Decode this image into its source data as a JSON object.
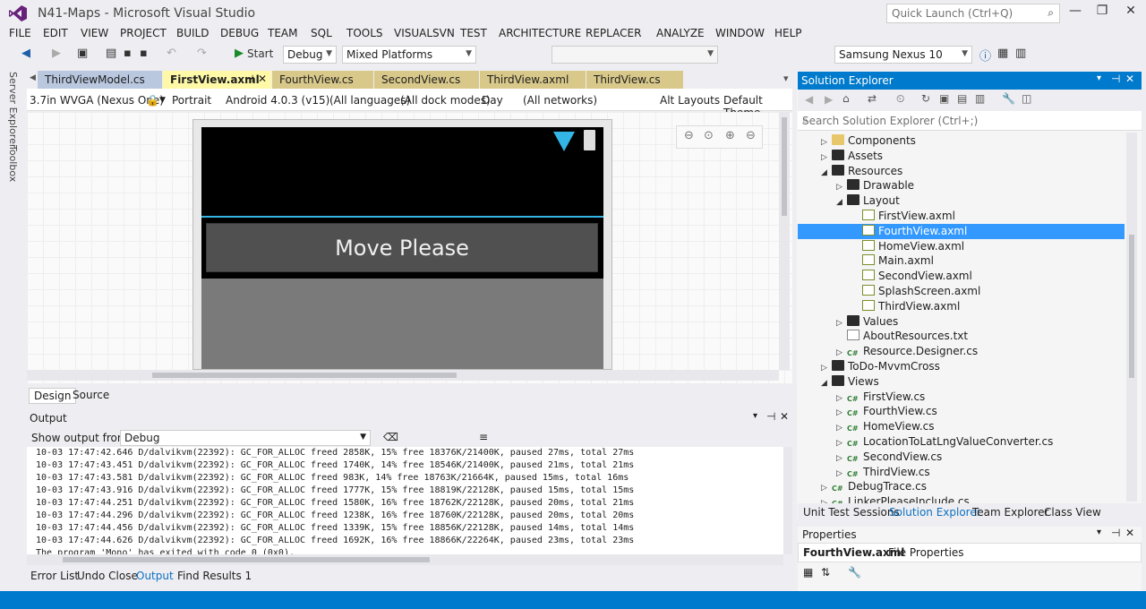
{
  "window": {
    "title": "N41-Maps - Microsoft Visual Studio",
    "quick_launch": "Quick Launch (Ctrl+Q)"
  },
  "menu": [
    "FILE",
    "EDIT",
    "VIEW",
    "PROJECT",
    "BUILD",
    "DEBUG",
    "TEAM",
    "SQL",
    "TOOLS",
    "VISUALSVN",
    "TEST",
    "ARCHITECTURE",
    "REPLACER",
    "ANALYZE",
    "WINDOW",
    "HELP"
  ],
  "toolbar": {
    "start": "Start",
    "config": "Debug",
    "platform": "Mixed Platforms",
    "device": "Samsung Nexus 10"
  },
  "side_tabs": [
    "Server Explorer",
    "Toolbox"
  ],
  "doc_tabs": [
    "ThirdViewModel.cs",
    "FirstView.axml",
    "FourthView.cs",
    "SecondView.cs",
    "ThirdView.axml",
    "ThirdView.cs"
  ],
  "designer": {
    "device": "3.7in WVGA (Nexus One)",
    "orientation": "Portrait",
    "api": "Android 4.0.3 (v15)",
    "languages": "(All languages)",
    "dock": "(All dock modes)",
    "day": "Day",
    "networks": "(All networks)",
    "alt_layouts": "Alt Layouts",
    "theme": "Default Theme",
    "button_text": "Move Please",
    "tab_design": "Design",
    "tab_source": "Source"
  },
  "output": {
    "title": "Output",
    "show_from_label": "Show output from:",
    "show_from_value": "Debug",
    "lines": [
      "10-03 17:47:42.646 D/dalvikvm(22392): GC_FOR_ALLOC freed 2858K, 15% free 18376K/21400K, paused 27ms, total 27ms",
      "10-03 17:47:43.451 D/dalvikvm(22392): GC_FOR_ALLOC freed 1740K, 14% free 18546K/21400K, paused 21ms, total 21ms",
      "10-03 17:47:43.581 D/dalvikvm(22392): GC_FOR_ALLOC freed 983K, 14% free 18763K/21664K, paused 15ms, total 16ms",
      "10-03 17:47:43.916 D/dalvikvm(22392): GC_FOR_ALLOC freed 1777K, 15% free 18819K/22128K, paused 15ms, total 15ms",
      "10-03 17:47:44.251 D/dalvikvm(22392): GC_FOR_ALLOC freed 1580K, 16% free 18762K/22128K, paused 20ms, total 21ms",
      "10-03 17:47:44.296 D/dalvikvm(22392): GC_FOR_ALLOC freed 1238K, 16% free 18760K/22128K, paused 20ms, total 20ms",
      "10-03 17:47:44.456 D/dalvikvm(22392): GC_FOR_ALLOC freed 1339K, 15% free 18856K/22128K, paused 14ms, total 14ms",
      "10-03 17:47:44.626 D/dalvikvm(22392): GC_FOR_ALLOC freed 1692K, 16% free 18866K/22264K, paused 23ms, total 23ms",
      "The program 'Mono' has exited with code 0 (0x0)."
    ]
  },
  "bottom_tabs": [
    "Error List",
    "Undo Close",
    "Output",
    "Find Results 1"
  ],
  "solution_explorer": {
    "title": "Solution Explorer",
    "search_placeholder": "Search Solution Explorer (Ctrl+;)",
    "items": [
      {
        "label": "Components",
        "type": "folder-y",
        "depth": 1,
        "exp": "collapsed"
      },
      {
        "label": "Assets",
        "type": "folder",
        "depth": 1,
        "exp": "collapsed"
      },
      {
        "label": "Resources",
        "type": "folder",
        "depth": 1,
        "exp": "expanded"
      },
      {
        "label": "Drawable",
        "type": "folder",
        "depth": 2,
        "exp": "collapsed"
      },
      {
        "label": "Layout",
        "type": "folder",
        "depth": 2,
        "exp": "expanded"
      },
      {
        "label": "FirstView.axml",
        "type": "axml",
        "depth": 3,
        "exp": "none"
      },
      {
        "label": "FourthView.axml",
        "type": "axml",
        "depth": 3,
        "exp": "none",
        "selected": true
      },
      {
        "label": "HomeView.axml",
        "type": "axml",
        "depth": 3,
        "exp": "none"
      },
      {
        "label": "Main.axml",
        "type": "axml",
        "depth": 3,
        "exp": "none"
      },
      {
        "label": "SecondView.axml",
        "type": "axml",
        "depth": 3,
        "exp": "none"
      },
      {
        "label": "SplashScreen.axml",
        "type": "axml",
        "depth": 3,
        "exp": "none"
      },
      {
        "label": "ThirdView.axml",
        "type": "axml",
        "depth": 3,
        "exp": "none"
      },
      {
        "label": "Values",
        "type": "folder",
        "depth": 2,
        "exp": "collapsed"
      },
      {
        "label": "AboutResources.txt",
        "type": "file",
        "depth": 2,
        "exp": "none"
      },
      {
        "label": "Resource.Designer.cs",
        "type": "cs",
        "depth": 2,
        "exp": "collapsed"
      },
      {
        "label": "ToDo-MvvmCross",
        "type": "folder",
        "depth": 1,
        "exp": "collapsed"
      },
      {
        "label": "Views",
        "type": "folder",
        "depth": 1,
        "exp": "expanded"
      },
      {
        "label": "FirstView.cs",
        "type": "cs",
        "depth": 2,
        "exp": "collapsed"
      },
      {
        "label": "FourthView.cs",
        "type": "cs",
        "depth": 2,
        "exp": "collapsed"
      },
      {
        "label": "HomeView.cs",
        "type": "cs",
        "depth": 2,
        "exp": "collapsed"
      },
      {
        "label": "LocationToLatLngValueConverter.cs",
        "type": "cs",
        "depth": 2,
        "exp": "collapsed"
      },
      {
        "label": "SecondView.cs",
        "type": "cs",
        "depth": 2,
        "exp": "collapsed"
      },
      {
        "label": "ThirdView.cs",
        "type": "cs",
        "depth": 2,
        "exp": "collapsed"
      },
      {
        "label": "DebugTrace.cs",
        "type": "cs",
        "depth": 1,
        "exp": "collapsed"
      },
      {
        "label": "LinkerPleaseInclude.cs",
        "type": "cs",
        "depth": 1,
        "exp": "collapsed"
      }
    ]
  },
  "se_tabs": [
    "Unit Test Sessions",
    "Solution Explorer",
    "Team Explorer",
    "Class View"
  ],
  "properties": {
    "title": "Properties",
    "file": "FourthView.axml",
    "kind": "File Properties"
  }
}
